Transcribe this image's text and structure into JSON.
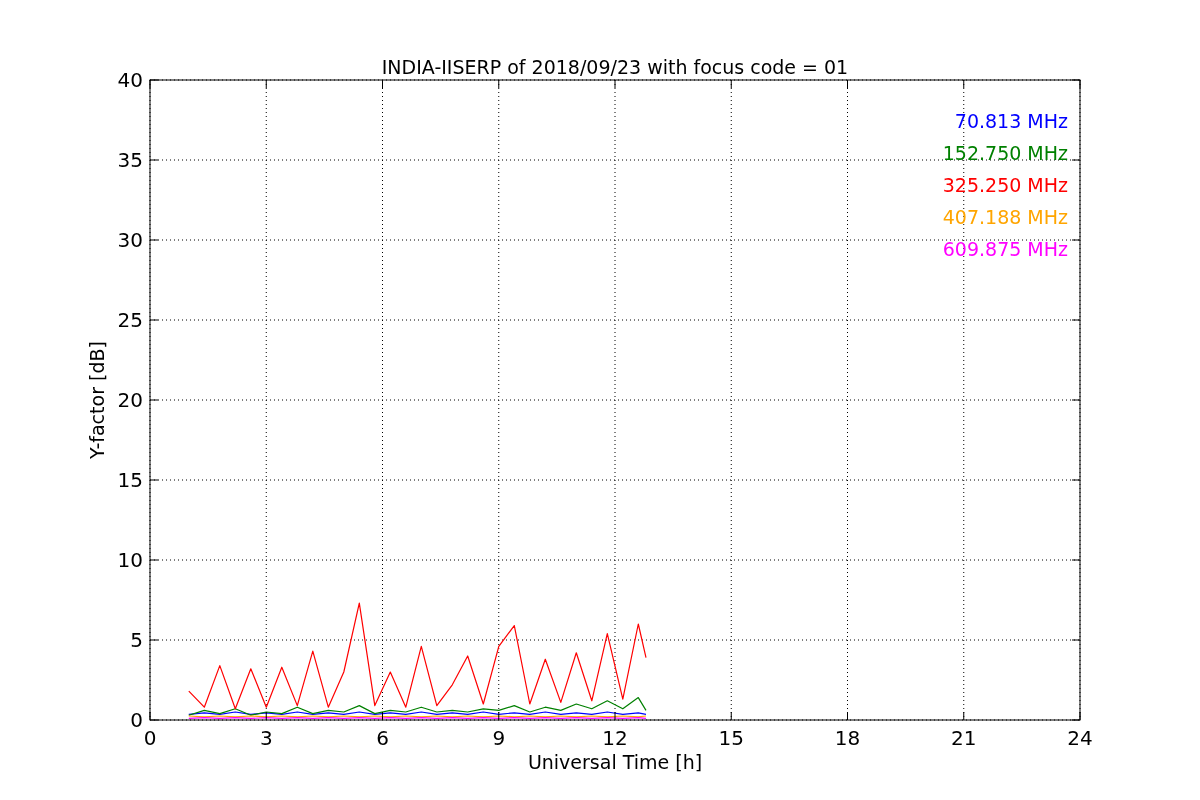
{
  "chart_data": {
    "type": "line",
    "title": "INDIA-IISERP of 2018/09/23 with focus code = 01",
    "xlabel": "Universal Time [h]",
    "ylabel": "Y-factor [dB]",
    "x": [
      1.0,
      1.4,
      1.8,
      2.2,
      2.6,
      3.0,
      3.4,
      3.8,
      4.2,
      4.6,
      5.0,
      5.4,
      5.8,
      6.2,
      6.6,
      7.0,
      7.4,
      7.8,
      8.2,
      8.6,
      9.0,
      9.4,
      9.8,
      10.2,
      10.6,
      11.0,
      11.4,
      11.8,
      12.2,
      12.6,
      12.8
    ],
    "series": [
      {
        "name": "70.813 MHz",
        "color": "#0000ff",
        "values": [
          0.35,
          0.45,
          0.35,
          0.5,
          0.35,
          0.45,
          0.35,
          0.5,
          0.35,
          0.45,
          0.35,
          0.5,
          0.35,
          0.45,
          0.35,
          0.5,
          0.35,
          0.45,
          0.35,
          0.5,
          0.35,
          0.45,
          0.35,
          0.5,
          0.35,
          0.45,
          0.35,
          0.5,
          0.35,
          0.45,
          0.35
        ]
      },
      {
        "name": "152.750 MHz",
        "color": "#008000",
        "values": [
          0.3,
          0.6,
          0.4,
          0.7,
          0.3,
          0.5,
          0.4,
          0.8,
          0.4,
          0.6,
          0.5,
          0.9,
          0.4,
          0.6,
          0.5,
          0.8,
          0.5,
          0.6,
          0.5,
          0.7,
          0.6,
          0.9,
          0.5,
          0.8,
          0.6,
          1.0,
          0.7,
          1.2,
          0.7,
          1.4,
          0.6
        ]
      },
      {
        "name": "325.250 MHz",
        "color": "#ff0000",
        "values": [
          1.8,
          0.8,
          3.4,
          0.7,
          3.2,
          0.8,
          3.3,
          0.9,
          4.3,
          0.8,
          3.0,
          7.3,
          0.9,
          3.0,
          0.8,
          4.6,
          0.9,
          2.2,
          4.0,
          1.0,
          4.6,
          5.9,
          1.0,
          3.8,
          1.1,
          4.2,
          1.2,
          5.4,
          1.3,
          6.0,
          3.9
        ]
      },
      {
        "name": "407.188 MHz",
        "color": "#ffa500",
        "values": [
          0.25,
          0.2,
          0.25,
          0.2,
          0.25,
          0.2,
          0.25,
          0.2,
          0.25,
          0.2,
          0.25,
          0.2,
          0.25,
          0.2,
          0.25,
          0.2,
          0.25,
          0.2,
          0.25,
          0.2,
          0.25,
          0.2,
          0.25,
          0.2,
          0.25,
          0.2,
          0.25,
          0.2,
          0.25,
          0.2,
          0.25
        ]
      },
      {
        "name": "609.875 MHz",
        "color": "#ff00ff",
        "values": [
          0.1,
          0.15,
          0.1,
          0.15,
          0.1,
          0.15,
          0.1,
          0.15,
          0.1,
          0.15,
          0.1,
          0.15,
          0.1,
          0.15,
          0.1,
          0.15,
          0.1,
          0.15,
          0.1,
          0.15,
          0.1,
          0.15,
          0.1,
          0.15,
          0.1,
          0.15,
          0.1,
          0.15,
          0.1,
          0.15,
          0.1
        ]
      }
    ],
    "grid": true,
    "xlim": [
      0,
      24
    ],
    "ylim": [
      0,
      40
    ],
    "xticks": [
      0,
      3,
      6,
      9,
      12,
      15,
      18,
      21,
      24
    ],
    "yticks": [
      0,
      5,
      10,
      15,
      20,
      25,
      30,
      35,
      40
    ]
  }
}
